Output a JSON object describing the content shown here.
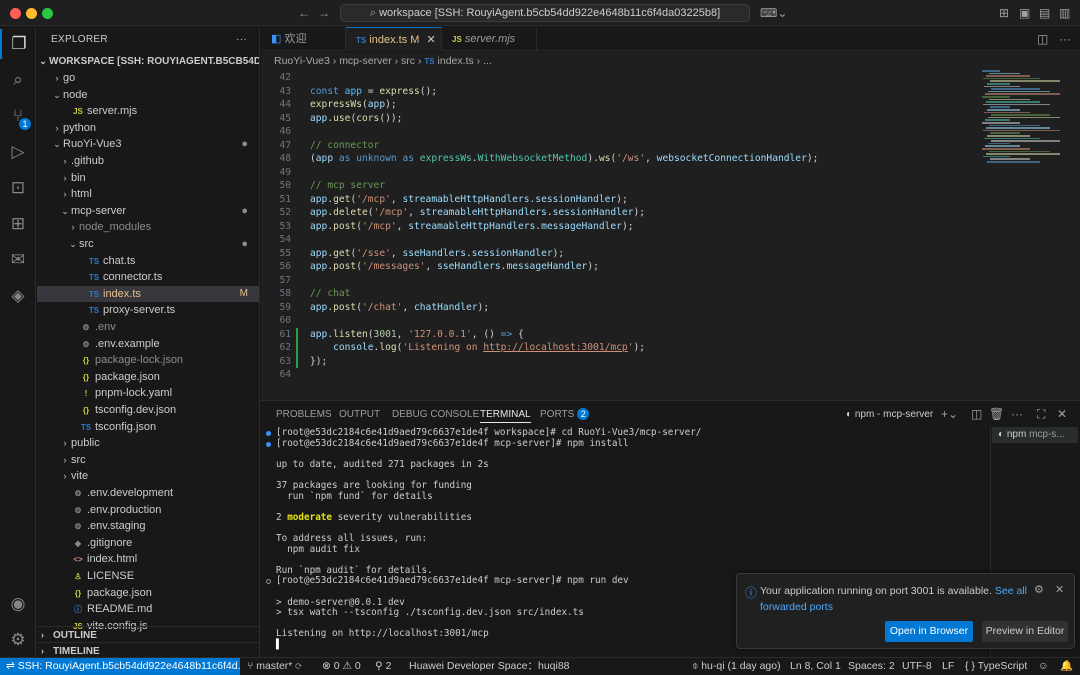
{
  "titlebar": {
    "search_text": "workspace [SSH: RouyiAgent.b5cb54dd922e4648b11c6f4da03225b8]"
  },
  "explorer": {
    "title": "EXPLORER",
    "workspace_title": "WORKSPACE [SSH: ROUYIAGENT.B5CB54DD92...",
    "items": [
      {
        "label": "go",
        "depth": 1,
        "chev": "›",
        "icon": ""
      },
      {
        "label": "node",
        "depth": 1,
        "chev": "⌄",
        "icon": ""
      },
      {
        "label": "server.mjs",
        "depth": 2,
        "chev": "",
        "icon": "JS"
      },
      {
        "label": "python",
        "depth": 1,
        "chev": "›",
        "icon": ""
      },
      {
        "label": "RuoYi-Vue3",
        "depth": 1,
        "chev": "⌄",
        "icon": "",
        "mark": "●"
      },
      {
        "label": ".github",
        "depth": 2,
        "chev": "›",
        "icon": ""
      },
      {
        "label": "bin",
        "depth": 2,
        "chev": "›",
        "icon": ""
      },
      {
        "label": "html",
        "depth": 2,
        "chev": "›",
        "icon": ""
      },
      {
        "label": "mcp-server",
        "depth": 2,
        "chev": "⌄",
        "icon": "",
        "mark": "●"
      },
      {
        "label": "node_modules",
        "depth": 3,
        "chev": "›",
        "icon": "",
        "dim": true
      },
      {
        "label": "src",
        "depth": 3,
        "chev": "⌄",
        "icon": "",
        "mark": "●"
      },
      {
        "label": "chat.ts",
        "depth": 4,
        "chev": "",
        "icon": "TS"
      },
      {
        "label": "connector.ts",
        "depth": 4,
        "chev": "",
        "icon": "TS"
      },
      {
        "label": "index.ts",
        "depth": 4,
        "chev": "",
        "icon": "TS",
        "mark": "M",
        "selected": true
      },
      {
        "label": "proxy-server.ts",
        "depth": 4,
        "chev": "",
        "icon": "TS"
      },
      {
        "label": ".env",
        "depth": 3,
        "chev": "",
        "icon": "⚙",
        "dim": true
      },
      {
        "label": ".env.example",
        "depth": 3,
        "chev": "",
        "icon": "⚙"
      },
      {
        "label": "package-lock.json",
        "depth": 3,
        "chev": "",
        "icon": "{}",
        "dim": true
      },
      {
        "label": "package.json",
        "depth": 3,
        "chev": "",
        "icon": "{}"
      },
      {
        "label": "pnpm-lock.yaml",
        "depth": 3,
        "chev": "",
        "icon": "!"
      },
      {
        "label": "tsconfig.dev.json",
        "depth": 3,
        "chev": "",
        "icon": "{}"
      },
      {
        "label": "tsconfig.json",
        "depth": 3,
        "chev": "",
        "icon": "TS"
      },
      {
        "label": "public",
        "depth": 2,
        "chev": "›",
        "icon": ""
      },
      {
        "label": "src",
        "depth": 2,
        "chev": "›",
        "icon": ""
      },
      {
        "label": "vite",
        "depth": 2,
        "chev": "›",
        "icon": ""
      },
      {
        "label": ".env.development",
        "depth": 2,
        "chev": "",
        "icon": "⚙"
      },
      {
        "label": ".env.production",
        "depth": 2,
        "chev": "",
        "icon": "⚙"
      },
      {
        "label": ".env.staging",
        "depth": 2,
        "chev": "",
        "icon": "⚙"
      },
      {
        "label": ".gitignore",
        "depth": 2,
        "chev": "",
        "icon": "◆"
      },
      {
        "label": "index.html",
        "depth": 2,
        "chev": "",
        "icon": "<>"
      },
      {
        "label": "LICENSE",
        "depth": 2,
        "chev": "",
        "icon": "♙"
      },
      {
        "label": "package.json",
        "depth": 2,
        "chev": "",
        "icon": "{}"
      },
      {
        "label": "README.md",
        "depth": 2,
        "chev": "",
        "icon": "ⓘ"
      },
      {
        "label": "vite.config.js",
        "depth": 2,
        "chev": "",
        "icon": "JS"
      }
    ],
    "outline": "OUTLINE",
    "timeline": "TIMELINE"
  },
  "tabs": [
    {
      "label": "欢迎",
      "icon": "◧"
    },
    {
      "label": "index.ts",
      "suffix": "M",
      "icon": "TS",
      "active": true
    },
    {
      "label": "server.mjs",
      "icon": "JS"
    }
  ],
  "breadcrumb": [
    "RuoYi-Vue3",
    "mcp-server",
    "src",
    "index.ts",
    "..."
  ],
  "code": [
    {
      "n": "42",
      "html": ""
    },
    {
      "n": "43",
      "html": "<span class='kw'>const</span> <span class='var2'>app</span> = <span class='fn'>express</span>();"
    },
    {
      "n": "44",
      "html": "<span class='fn'>expressWs</span>(<span class='vr'>app</span>);"
    },
    {
      "n": "45",
      "html": "<span class='vr'>app</span>.<span class='fn'>use</span>(<span class='fn'>cors</span>());"
    },
    {
      "n": "46",
      "html": ""
    },
    {
      "n": "47",
      "html": "<span class='cm'>// connector</span>"
    },
    {
      "n": "48",
      "html": "(<span class='vr'>app</span> <span class='kw'>as</span> <span class='kw'>unknown</span> <span class='kw'>as</span> <span class='ty'>expressWs</span>.<span class='ty'>WithWebsocketMethod</span>).<span class='fn'>ws</span>(<span class='str'>'/ws'</span>, <span class='vr'>websocketConnectionHandler</span>);"
    },
    {
      "n": "49",
      "html": ""
    },
    {
      "n": "50",
      "html": "<span class='cm'>// mcp server</span>"
    },
    {
      "n": "51",
      "html": "<span class='vr'>app</span>.<span class='fn'>get</span>(<span class='str'>'/mcp'</span>, <span class='vr'>streamableHttpHandlers</span>.<span class='vr'>sessionHandler</span>);"
    },
    {
      "n": "52",
      "html": "<span class='vr'>app</span>.<span class='fn'>delete</span>(<span class='str'>'/mcp'</span>, <span class='vr'>streamableHttpHandlers</span>.<span class='vr'>sessionHandler</span>);"
    },
    {
      "n": "53",
      "html": "<span class='vr'>app</span>.<span class='fn'>post</span>(<span class='str'>'/mcp'</span>, <span class='vr'>streamableHttpHandlers</span>.<span class='vr'>messageHandler</span>);"
    },
    {
      "n": "54",
      "html": ""
    },
    {
      "n": "55",
      "html": "<span class='vr'>app</span>.<span class='fn'>get</span>(<span class='str'>'/sse'</span>, <span class='vr'>sseHandlers</span>.<span class='vr'>sessionHandler</span>);"
    },
    {
      "n": "56",
      "html": "<span class='vr'>app</span>.<span class='fn'>post</span>(<span class='str'>'/messages'</span>, <span class='vr'>sseHandlers</span>.<span class='vr'>messageHandler</span>);"
    },
    {
      "n": "57",
      "html": ""
    },
    {
      "n": "58",
      "html": "<span class='cm'>// chat</span>"
    },
    {
      "n": "59",
      "html": "<span class='vr'>app</span>.<span class='fn'>post</span>(<span class='str'>'/chat'</span>, <span class='vr'>chatHandler</span>);"
    },
    {
      "n": "60",
      "html": ""
    },
    {
      "n": "61",
      "html": "<span class='vr'>app</span>.<span class='fn'>listen</span>(<span class='num'>3001</span>, <span class='str'>'127.0.0.1'</span>, () <span class='kw'>=&gt;</span> {"
    },
    {
      "n": "62",
      "html": "    <span class='vr'>console</span>.<span class='fn'>log</span>(<span class='str'>'Listening on </span><span class='lnk'>http://localhost:3001/mcp</span><span class='str'>'</span>);"
    },
    {
      "n": "63",
      "html": "});"
    },
    {
      "n": "64",
      "html": ""
    }
  ],
  "panel": {
    "tabs": [
      {
        "label": "PROBLEMS"
      },
      {
        "label": "OUTPUT"
      },
      {
        "label": "DEBUG CONSOLE"
      },
      {
        "label": "TERMINAL",
        "active": true
      },
      {
        "label": "PORTS",
        "badge": "2"
      }
    ],
    "terminal_name": "npm - mcp-server",
    "side_entry": "npm",
    "side_entry_sub": "mcp-s...",
    "lines": [
      {
        "dot": "blue",
        "text": "[root@e53dc2184c6e41d9aed79c6637e1de4f workspace]# cd RuoYi-Vue3/mcp-server/"
      },
      {
        "dot": "blue",
        "text": "[root@e53dc2184c6e41d9aed79c6637e1de4f mcp-server]# npm install"
      },
      {
        "text": ""
      },
      {
        "text": "up to date, audited 271 packages in 2s"
      },
      {
        "text": ""
      },
      {
        "text": "37 packages are looking for funding"
      },
      {
        "text": "  run `npm fund` for details"
      },
      {
        "text": ""
      },
      {
        "text": "2 moderate severity vulnerabilities",
        "bold_word": "moderate"
      },
      {
        "text": ""
      },
      {
        "text": "To address all issues, run:"
      },
      {
        "text": "  npm audit fix"
      },
      {
        "text": ""
      },
      {
        "text": "Run `npm audit` for details."
      },
      {
        "dot": "grey",
        "text": "[root@e53dc2184c6e41d9aed79c6637e1de4f mcp-server]# npm run dev"
      },
      {
        "text": ""
      },
      {
        "text": "> demo-server@0.0.1 dev"
      },
      {
        "text": "> tsx watch --tsconfig ./tsconfig.dev.json src/index.ts"
      },
      {
        "text": ""
      },
      {
        "text": "Listening on http://localhost:3001/mcp"
      },
      {
        "text": "▌",
        "cursor": true
      }
    ]
  },
  "notification": {
    "message": "Your application running on port 3001 is available.",
    "link": "See all forwarded ports",
    "primary": "Open in Browser",
    "secondary": "Preview in Editor"
  },
  "statusbar": {
    "remote": "SSH: RouyiAgent.b5cb54dd922e4648b11c6f4d...",
    "branch": "master*",
    "errors": "0",
    "warnings": "0",
    "ports": "2",
    "huawei": "Huawei Developer Space：huqi88",
    "blame": "hu-qi (1 day ago)",
    "position": "Ln 8, Col 1",
    "spaces": "Spaces: 2",
    "encoding": "UTF-8",
    "eol": "LF",
    "language": "TypeScript"
  },
  "colors": {
    "accent": "#0078d4",
    "modified": "#e2c08d"
  }
}
